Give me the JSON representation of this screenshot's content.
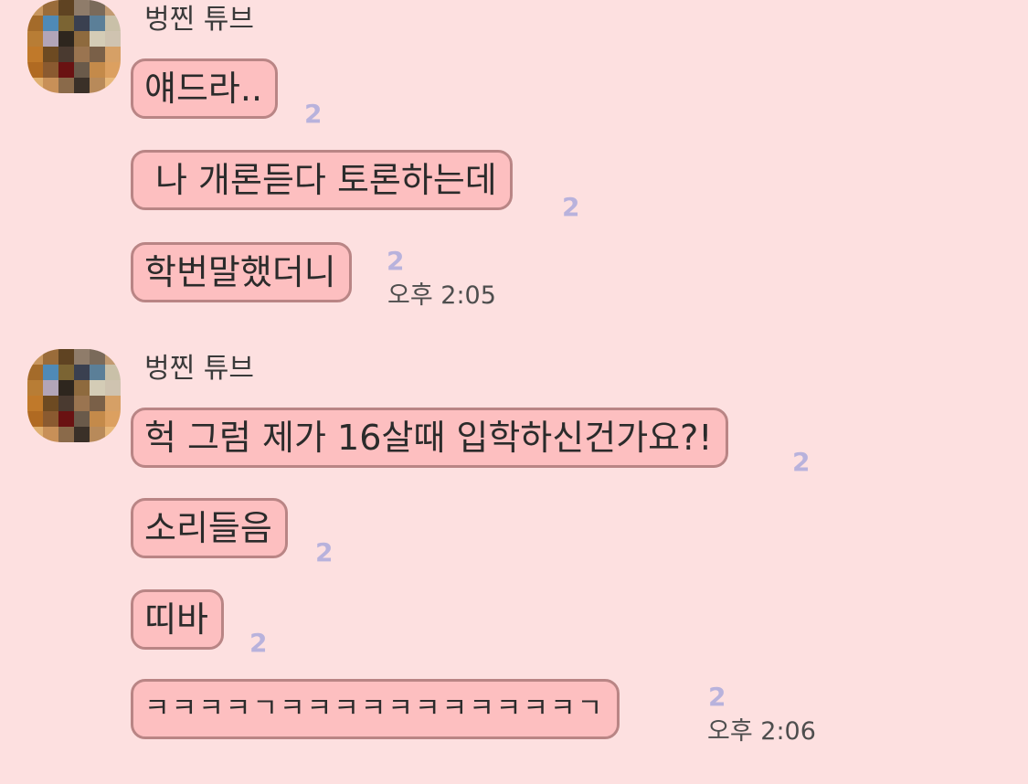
{
  "groups": [
    {
      "sender": "벙찐 튜브",
      "messages": [
        {
          "text": "얘드라..",
          "unread": "2",
          "time": ""
        },
        {
          "text": "나 개론듣다 토론하는데",
          "unread": "2",
          "time": ""
        },
        {
          "text": "학번말했더니",
          "unread": "2",
          "time": "오후 2:05"
        }
      ]
    },
    {
      "sender": "벙찐 튜브",
      "messages": [
        {
          "text": "헉 그럼 제가 16살때 입학하신건가요?!",
          "unread": "2",
          "time": ""
        },
        {
          "text": "소리들음",
          "unread": "2",
          "time": ""
        },
        {
          "text": "띠바",
          "unread": "2",
          "time": ""
        },
        {
          "text": "ㅋㅋㅋㅋㄱㅋㅋㅋㅋㅋㅋㅋㅋㅋㅋㅋㄱ",
          "unread": "2",
          "time": "오후 2:06"
        }
      ]
    }
  ],
  "colors": {
    "background": "#fde0e0",
    "bubble_fill": "#fdbfc0",
    "bubble_border": "#b98585",
    "unread_count": "#b8b2dc"
  },
  "avatar": {
    "icon": "pixelated-profile-photo",
    "palette": [
      "#c7955d",
      "#9a6c3a",
      "#5f4322",
      "#8f7c6a",
      "#7a6a5a",
      "#c29a70",
      "#a46b2a",
      "#4f8ab6",
      "#7b6433",
      "#3a4050",
      "#5b7f98",
      "#c9c0a8",
      "#b87d35",
      "#b2a5b8",
      "#2e261e",
      "#8e6a3e",
      "#d4ccb6",
      "#cfc3b0",
      "#c0792a",
      "#6d4a22",
      "#4a3a30",
      "#9a7450",
      "#7a6048",
      "#d6a066",
      "#b06a22",
      "#8a5a30",
      "#6a1212",
      "#6a5a4a",
      "#c48a4a",
      "#dca060",
      "#e0b070",
      "#c89058",
      "#8a6a4a",
      "#3a3028",
      "#b88a5a",
      "#e8b87a"
    ]
  }
}
